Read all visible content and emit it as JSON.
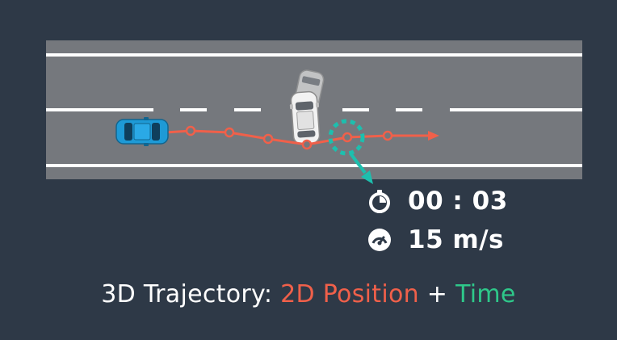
{
  "readouts": {
    "time": "00 : 03",
    "speed": "15 m/s",
    "time_icon": "stopwatch-icon",
    "speed_icon": "speedometer-icon"
  },
  "caption": {
    "prefix": "3D Trajectory: ",
    "position": "2D Position",
    "plus": " + ",
    "time": "Time"
  },
  "colors": {
    "background": "#2e3947",
    "road": "#75787d",
    "lane_line": "#ffffff",
    "trajectory": "#f0604a",
    "highlight": "#1dbfae",
    "ego_car": "#1e9ad6",
    "other_car": "#e6e6e6",
    "position_text": "#f0604a",
    "time_text": "#2ec88a"
  }
}
